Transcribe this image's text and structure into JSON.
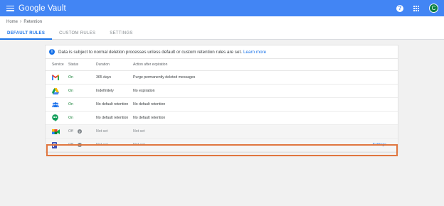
{
  "app": {
    "title": "Google Vault",
    "avatar_letter": "C"
  },
  "breadcrumb": {
    "home": "Home",
    "separator": "›",
    "current": "Retention"
  },
  "tabs": [
    {
      "label": "DEFAULT RULES",
      "active": true
    },
    {
      "label": "CUSTOM RULES",
      "active": false
    },
    {
      "label": "SETTINGS",
      "active": false
    }
  ],
  "banner": {
    "text": "Data is subject to normal deletion processes unless default or custom retention rules are set.",
    "link": "Learn more"
  },
  "table": {
    "headers": {
      "service": "Service",
      "status": "Status",
      "duration": "Duration",
      "action": "Action after expiration"
    },
    "rows": [
      {
        "service_icon": "gmail-icon",
        "status": "On",
        "duration": "365 days",
        "action": "Purge permanently deleted messages"
      },
      {
        "service_icon": "drive-icon",
        "status": "On",
        "duration": "Indefinitely",
        "action": "No expiration"
      },
      {
        "service_icon": "groups-icon",
        "status": "On",
        "duration": "No default retention",
        "action": "No default retention"
      },
      {
        "service_icon": "hangouts-chat-icon",
        "status": "On",
        "duration": "No default retention",
        "action": "No default retention"
      },
      {
        "service_icon": "meet-icon",
        "status": "Off",
        "duration": "Not set",
        "action": "Not set"
      },
      {
        "service_icon": "sites-icon",
        "status": "Off",
        "duration": "Not set",
        "action": "Not set",
        "link": "Settings"
      }
    ]
  },
  "colors": {
    "appbar": "#4285f4",
    "accent": "#1a73e8",
    "highlight": "#e0763f"
  }
}
